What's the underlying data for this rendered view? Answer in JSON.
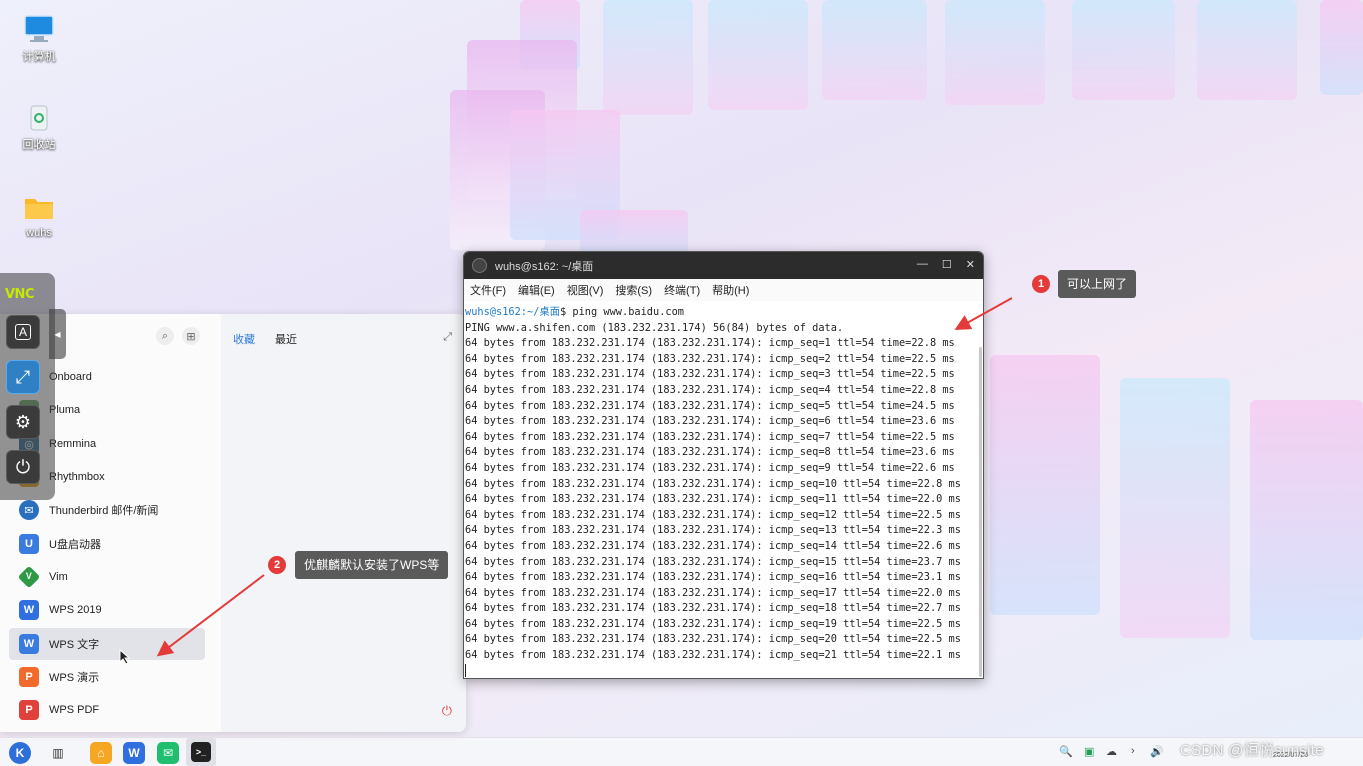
{
  "desktop": {
    "icons": [
      {
        "label": "计算机",
        "icon": "computer-icon"
      },
      {
        "label": "回收站",
        "icon": "trash-icon"
      },
      {
        "label": "wuhs",
        "icon": "folder-icon"
      }
    ]
  },
  "vnc_toolbar": {
    "logo": "VNC",
    "buttons": [
      {
        "glyph": "A",
        "icon": "keyboard-icon"
      },
      {
        "glyph": "⤢",
        "icon": "fullscreen-icon"
      },
      {
        "glyph": "⚙",
        "icon": "settings-icon"
      },
      {
        "glyph": "⏻",
        "icon": "power-icon"
      }
    ],
    "handle_glyph": "◀"
  },
  "start_menu": {
    "tabs": {
      "favorites": "收藏",
      "recent": "最近"
    },
    "apps": [
      {
        "label": "Onboard",
        "color": "#7aa3d8"
      },
      {
        "label": "Pluma",
        "color": "#6fa56b"
      },
      {
        "label": "Remmina",
        "color": "#3f6f8f"
      },
      {
        "label": "Rhythmbox",
        "color": "#e0a020"
      },
      {
        "label": "Thunderbird 邮件/新闻",
        "color": "#2a6fbf"
      },
      {
        "label": "U盘启动器",
        "color": "#3a7be0"
      },
      {
        "label": "Vim",
        "color": "#2e9a46"
      },
      {
        "label": "WPS 2019",
        "color": "#2f6fe0"
      },
      {
        "label": "WPS 文字",
        "color": "#3a7be0"
      },
      {
        "label": "WPS 演示",
        "color": "#ef6a2c"
      },
      {
        "label": "WPS PDF",
        "color": "#e0413a"
      }
    ],
    "selected_index": 8
  },
  "terminal": {
    "title": "wuhs@s162: ~/桌面",
    "menu": [
      "文件(F)",
      "编辑(E)",
      "视图(V)",
      "搜索(S)",
      "终端(T)",
      "帮助(H)"
    ],
    "prompt_user": "wuhs@s162",
    "prompt_path": ":~/桌面",
    "prompt_cmd": "$ ping www.baidu.com",
    "lines": [
      "PING www.a.shifen.com (183.232.231.174) 56(84) bytes of data.",
      "64 bytes from 183.232.231.174 (183.232.231.174): icmp_seq=1 ttl=54 time=22.8 ms",
      "64 bytes from 183.232.231.174 (183.232.231.174): icmp_seq=2 ttl=54 time=22.5 ms",
      "64 bytes from 183.232.231.174 (183.232.231.174): icmp_seq=3 ttl=54 time=22.5 ms",
      "64 bytes from 183.232.231.174 (183.232.231.174): icmp_seq=4 ttl=54 time=22.8 ms",
      "64 bytes from 183.232.231.174 (183.232.231.174): icmp_seq=5 ttl=54 time=24.5 ms",
      "64 bytes from 183.232.231.174 (183.232.231.174): icmp_seq=6 ttl=54 time=23.6 ms",
      "64 bytes from 183.232.231.174 (183.232.231.174): icmp_seq=7 ttl=54 time=22.5 ms",
      "64 bytes from 183.232.231.174 (183.232.231.174): icmp_seq=8 ttl=54 time=23.6 ms",
      "64 bytes from 183.232.231.174 (183.232.231.174): icmp_seq=9 ttl=54 time=22.6 ms",
      "64 bytes from 183.232.231.174 (183.232.231.174): icmp_seq=10 ttl=54 time=22.8 ms",
      "64 bytes from 183.232.231.174 (183.232.231.174): icmp_seq=11 ttl=54 time=22.0 ms",
      "64 bytes from 183.232.231.174 (183.232.231.174): icmp_seq=12 ttl=54 time=22.5 ms",
      "64 bytes from 183.232.231.174 (183.232.231.174): icmp_seq=13 ttl=54 time=22.3 ms",
      "64 bytes from 183.232.231.174 (183.232.231.174): icmp_seq=14 ttl=54 time=22.6 ms",
      "64 bytes from 183.232.231.174 (183.232.231.174): icmp_seq=15 ttl=54 time=23.7 ms",
      "64 bytes from 183.232.231.174 (183.232.231.174): icmp_seq=16 ttl=54 time=23.1 ms",
      "64 bytes from 183.232.231.174 (183.232.231.174): icmp_seq=17 ttl=54 time=22.0 ms",
      "64 bytes from 183.232.231.174 (183.232.231.174): icmp_seq=18 ttl=54 time=22.7 ms",
      "64 bytes from 183.232.231.174 (183.232.231.174): icmp_seq=19 ttl=54 time=22.5 ms",
      "64 bytes from 183.232.231.174 (183.232.231.174): icmp_seq=20 ttl=54 time=22.5 ms",
      "64 bytes from 183.232.231.174 (183.232.231.174): icmp_seq=21 ttl=54 time=22.1 ms"
    ]
  },
  "annotations": [
    {
      "num": "1",
      "text": "可以上网了"
    },
    {
      "num": "2",
      "text": "优麒麟默认安装了WPS等"
    }
  ],
  "taskbar": {
    "apps": [
      {
        "glyph": "K",
        "color": "#2d6fd8",
        "icon": "start-menu-icon"
      },
      {
        "glyph": "▥",
        "color": "#333333",
        "icon": "multitask-view-icon"
      },
      {
        "glyph": "⌂",
        "color": "#f5a623",
        "icon": "file-manager-icon"
      },
      {
        "glyph": "W",
        "color": "#2f6fe0",
        "icon": "wps-icon"
      },
      {
        "glyph": "✉",
        "color": "#1fbf6f",
        "icon": "chat-icon"
      },
      {
        "glyph": ">_",
        "color": "#222222",
        "icon": "terminal-icon"
      }
    ],
    "tray": [
      "🔍",
      "▣",
      "☁",
      "›",
      "🔊"
    ],
    "date": "2022/07/26",
    "watermark": "CSDN @恒悦sunsite"
  }
}
